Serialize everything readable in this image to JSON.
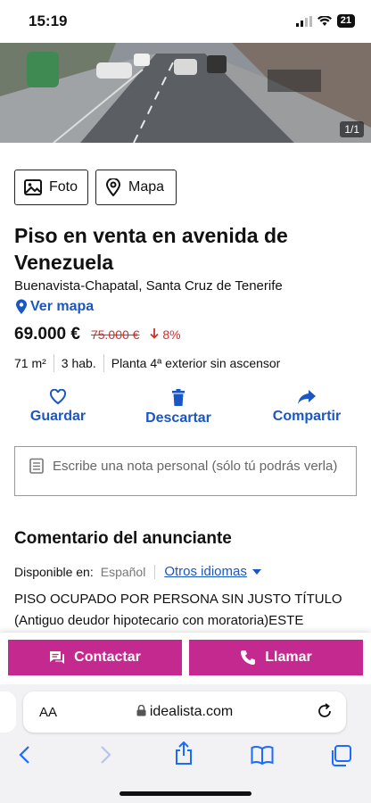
{
  "status": {
    "time": "15:19",
    "battery": "21"
  },
  "photo": {
    "counter": "1/1"
  },
  "buttons": {
    "foto": "Foto",
    "mapa": "Mapa"
  },
  "listing": {
    "title": "Piso en venta en avenida de Venezuela",
    "address": "Buenavista-Chapatal, Santa Cruz de Tenerife",
    "ver_mapa": "Ver mapa",
    "price": "69.000 €",
    "old_price": "75.000 €",
    "drop": "8%",
    "features": [
      "71 m²",
      "3 hab.",
      "Planta 4ª exterior sin ascensor"
    ]
  },
  "actions": {
    "guardar": "Guardar",
    "descartar": "Descartar",
    "compartir": "Compartir"
  },
  "note": {
    "placeholder": "Escribe una nota personal (sólo tú podrás verla)"
  },
  "comment": {
    "title": "Comentario del anunciante",
    "available_label": "Disponible en:",
    "current_lang": "Español",
    "other_langs": "Otros idiomas",
    "text": "PISO OCUPADO POR PERSONA SIN JUSTO TÍTULO (Antiguo deudor hipotecario con moratoria)ESTE"
  },
  "cta": {
    "contactar": "Contactar",
    "llamar": "Llamar"
  },
  "browser": {
    "aa": "AA",
    "url": "idealista.com"
  },
  "colors": {
    "accent": "#c3298f",
    "link": "#1a56c4",
    "price_drop": "#d0302f"
  }
}
